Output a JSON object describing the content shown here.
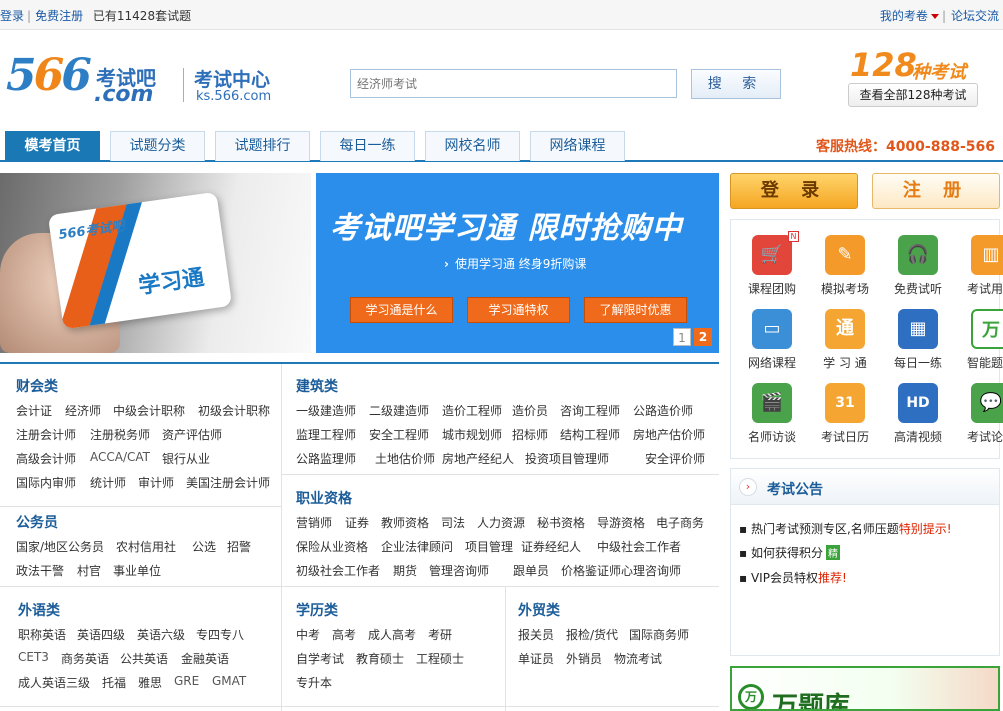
{
  "topbar": {
    "login": "登录",
    "register": "免费注册",
    "count_text": "已有11428套试题",
    "my_exam": "我的考卷",
    "forum": "论坛交流"
  },
  "header": {
    "logo_num_5": "5",
    "logo_num_6a": "6",
    "logo_num_6b": "6",
    "logo_brand": "考试吧",
    "logo_dotcom": ".com",
    "logo_center": "考试中心",
    "logo_domain": "ks.566.com",
    "search_placeholder": "经济师考试",
    "search_button": "搜 索",
    "exam_count_big": "128",
    "exam_count_kind": "种考试",
    "exam_count_sub": "查看全部128种考试"
  },
  "nav": {
    "tabs": [
      "模考首页",
      "试题分类",
      "试题排行",
      "每日一练",
      "网校名师",
      "网络课程"
    ],
    "hotline": "客服热线：4000-888-566"
  },
  "banner": {
    "card_logo": "566考试吧",
    "card_text": "学习通",
    "title": "考试吧学习通  限时抢购中",
    "subtitle": "使用学习通  终身9折购课",
    "buttons": [
      "学习通是什么",
      "学习通特权",
      "了解限时优惠"
    ],
    "pages": [
      "1",
      "2"
    ]
  },
  "categories": {
    "caikuai": {
      "title": "财会类",
      "rows": [
        [
          "会计证",
          "经济师",
          "中级会计职称",
          "初级会计职称"
        ],
        [
          "注册会计师",
          "注册税务师",
          "资产评估师"
        ],
        [
          "高级会计师",
          "ACCA/CAT",
          "银行从业"
        ],
        [
          "国际内审师",
          "统计师",
          "审计师",
          "美国注册会计师"
        ]
      ]
    },
    "jianzhu": {
      "title": "建筑类",
      "rows": [
        [
          "一级建造师",
          "二级建造师",
          "造价工程师",
          "造价员",
          "咨询工程师",
          "公路造价师"
        ],
        [
          "监理工程师",
          "安全工程师",
          "城市规划师",
          "招标师",
          "结构工程师",
          "房地产估价师"
        ],
        [
          "公路监理师",
          "土地估价师",
          "房地产经纪人",
          "投资项目管理师",
          "安全评价师"
        ]
      ]
    },
    "gongwuyuan": {
      "title": "公务员",
      "rows": [
        [
          "国家/地区公务员",
          "农村信用社",
          "公选",
          "招警"
        ],
        [
          "政法干警",
          "村官",
          "事业单位"
        ]
      ]
    },
    "zhiye": {
      "title": "职业资格",
      "rows": [
        [
          "营销师",
          "证券",
          "教师资格",
          "司法",
          "人力资源",
          "秘书资格",
          "导游资格",
          "电子商务"
        ],
        [
          "保险从业资格",
          "企业法律顾问",
          "项目管理",
          "证券经纪人",
          "中级社会工作者"
        ],
        [
          "初级社会工作者",
          "期货",
          "管理咨询师",
          "跟单员",
          "价格鉴证师",
          "心理咨询师"
        ]
      ]
    },
    "waiyu": {
      "title": "外语类",
      "rows": [
        [
          "职称英语",
          "英语四级",
          "英语六级",
          "专四专八"
        ],
        [
          "CET3",
          "商务英语",
          "公共英语",
          "金融英语"
        ],
        [
          "成人英语三级",
          "托福",
          "雅思",
          "GRE",
          "GMAT"
        ]
      ]
    },
    "xueli": {
      "title": "学历类",
      "rows": [
        [
          "中考",
          "高考",
          "成人高考",
          "考研"
        ],
        [
          "自学考试",
          "教育硕士",
          "工程硕士"
        ],
        [
          "专升本"
        ]
      ]
    },
    "waimao": {
      "title": "外贸类",
      "rows": [
        [
          "报关员",
          "报检/货代",
          "国际商务师"
        ],
        [
          "单证员",
          "外销员",
          "物流考试"
        ]
      ]
    }
  },
  "sidebar": {
    "login": "登 录",
    "register": "注 册",
    "services": [
      {
        "label": "课程团购",
        "icon": "cart-icon",
        "color": "#e2453a",
        "glyph": "🛒",
        "new": true
      },
      {
        "label": "模拟考场",
        "icon": "edit-icon",
        "color": "#f39a2b",
        "glyph": "✎",
        "new": false
      },
      {
        "label": "免费试听",
        "icon": "headphone-icon",
        "color": "#4aa34a",
        "glyph": "🎧",
        "new": false
      },
      {
        "label": "考试用书",
        "icon": "book-icon",
        "color": "#f39a2b",
        "glyph": "▥",
        "new": false
      },
      {
        "label": "网络课程",
        "icon": "monitor-icon",
        "color": "#3a8fd6",
        "glyph": "▭",
        "new": false
      },
      {
        "label": "学 习 通",
        "icon": "card-icon",
        "color": "#f5a531",
        "glyph": "通",
        "new": false
      },
      {
        "label": "每日一练",
        "icon": "calendar-grid-icon",
        "color": "#2e6fc2",
        "glyph": "▦",
        "new": false
      },
      {
        "label": "智能题库",
        "icon": "wan-bank-icon",
        "color": "#ffffff",
        "glyph": "万",
        "new": true
      },
      {
        "label": "名师访谈",
        "icon": "clapper-icon",
        "color": "#4aa34a",
        "glyph": "🎬",
        "new": false
      },
      {
        "label": "考试日历",
        "icon": "calendar-icon",
        "color": "#f5a531",
        "glyph": "31",
        "new": false
      },
      {
        "label": "高清视频",
        "icon": "hd-icon",
        "color": "#2e6fc2",
        "glyph": "HD",
        "new": false
      },
      {
        "label": "考试论坛",
        "icon": "chat-icon",
        "color": "#4aa34a",
        "glyph": "💬",
        "new": false
      }
    ],
    "new_tag": "N",
    "notice_title": "考试公告",
    "notice_arrow": "›",
    "notices": [
      {
        "prefix": "热门考试预测专区,名师压题",
        "red": "特别提示!",
        "tag": ""
      },
      {
        "prefix": "如何获得积分",
        "red": "",
        "tag": "精"
      },
      {
        "prefix": "VIP会员特权",
        "red": "推荐!",
        "tag": ""
      }
    ],
    "ad_logo": "万",
    "ad_text": "万题库"
  }
}
